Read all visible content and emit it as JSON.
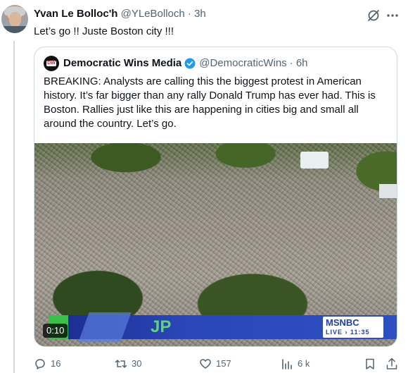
{
  "tweet": {
    "author_name": "Yvan Le Bolloc'h",
    "handle": "@YLeBolloch",
    "time": "· 3h",
    "text": "Let’s go !! Juste Boston city !!!"
  },
  "quote": {
    "avatar_text": "DW",
    "author_name": "Democratic Wins Media",
    "handle": "@DemocraticWins",
    "time": "· 6h",
    "text": "BREAKING: Analysts are calling this the biggest protest in American history. It’s far bigger than any rally Donald Trump has ever had. This is Boston. Rallies just like this are happening in cities big and small all around the country. Let’s go.",
    "video": {
      "duration": "0:10",
      "chyron_text": "JP",
      "network_logo": "MSNBC",
      "live_text": "LIVE › 11:35"
    }
  },
  "actions": {
    "replies": "16",
    "reposts": "30",
    "likes": "157",
    "views": "6 k"
  },
  "icons": [
    "grok-icon",
    "more-icon",
    "verified-badge-icon",
    "reply-icon",
    "retweet-icon",
    "like-icon",
    "views-icon",
    "bookmark-icon",
    "share-icon"
  ],
  "colors": {
    "verified": "#1d9bf0",
    "muted": "#536471",
    "border": "#cfd9de"
  }
}
